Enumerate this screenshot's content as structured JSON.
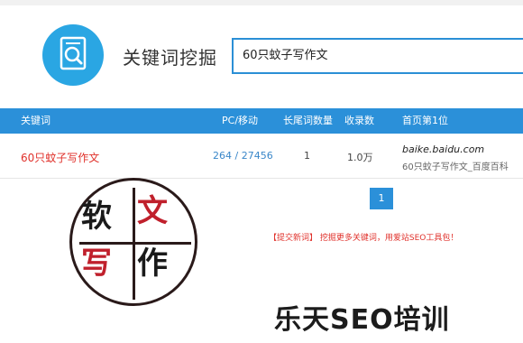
{
  "header": {
    "title": "关键词挖掘",
    "logo_icon": "search-document-icon",
    "accent_color": "#2aa6e3"
  },
  "search": {
    "value": "60只蚊子写作文"
  },
  "table": {
    "header_color": "#2b90d9",
    "columns": [
      "关键词",
      "PC/移动",
      "长尾词数量",
      "收录数",
      "首页第1位"
    ],
    "rows": [
      {
        "keyword": "60只蚊子写作文",
        "pc_mobile": "264 / 27456",
        "longtail_count": "1",
        "indexed": "1.0万",
        "first_domain": "baike.baidu.com",
        "first_title": "60只蚊子写作文_百度百科"
      }
    ]
  },
  "pagination": {
    "current_page": "1"
  },
  "promo": {
    "text": "【提交新词】 挖掘更多关键词，用爱站SEO工具包！"
  },
  "stamp": {
    "chars": [
      "软",
      "文",
      "写",
      "作"
    ]
  },
  "watermark": {
    "text": "乐天SEO培训"
  }
}
